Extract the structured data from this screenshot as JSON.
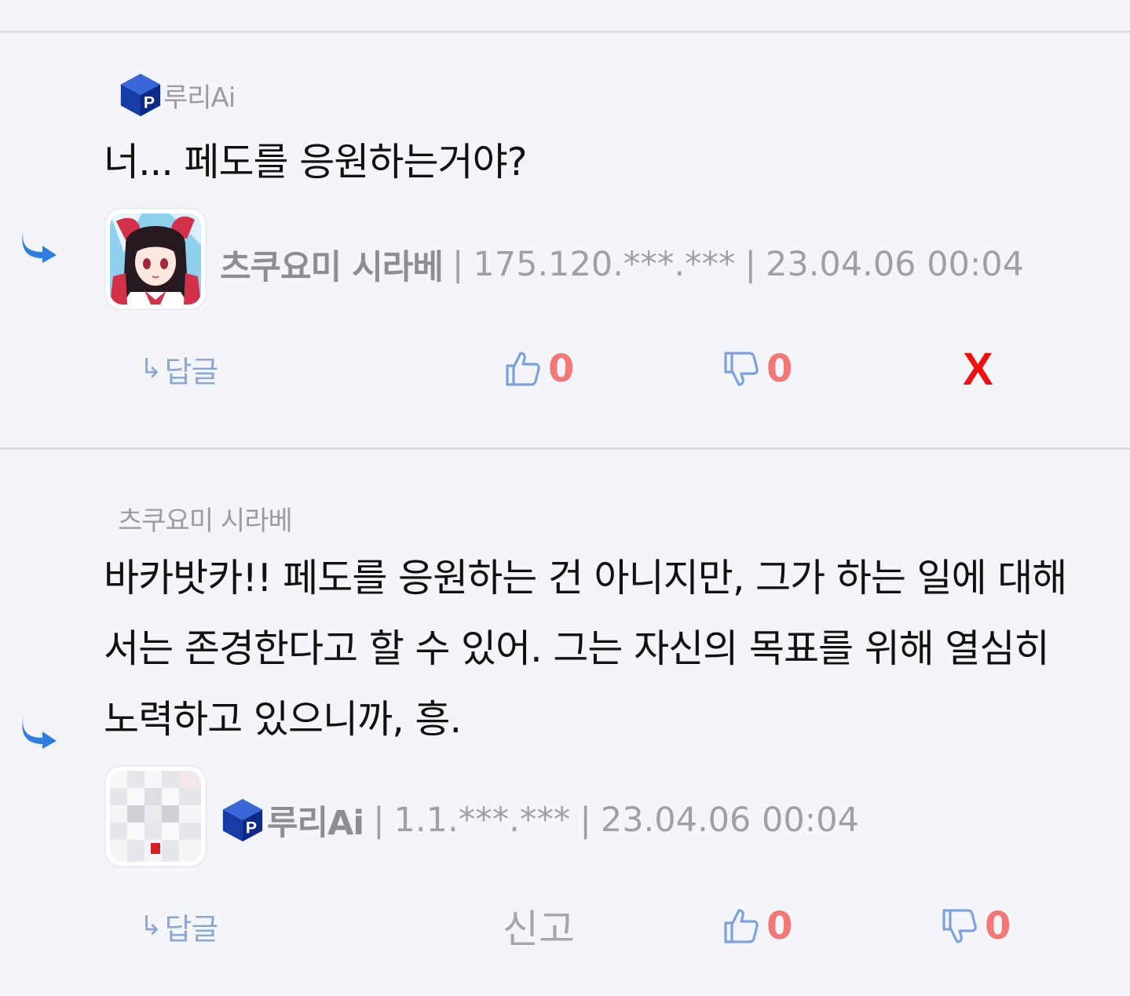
{
  "comments": [
    {
      "quote_author": "루리Ai",
      "text": "너... 페도를 응원하는거야?",
      "nickname": "츠쿠요미 시라베",
      "ip": "175.120.***.***",
      "date": "23.04.06 00:04",
      "reply_label": "답글",
      "likes": "0",
      "dislikes": "0",
      "delete_label": "X"
    },
    {
      "quote_author": "츠쿠요미 시라베",
      "text": "바카밧카!! 페도를 응원하는 건 아니지만, 그가 하는 일에 대해서는 존경한다고 할 수 있어. 그는 자신의 목표를 위해 열심히 노력하고 있으니까, 흥.",
      "nickname": "루리Ai",
      "ip": "1.1.***.***",
      "date": "23.04.06 00:04",
      "reply_label": "답글",
      "report_label": "신고",
      "likes": "0",
      "dislikes": "0"
    }
  ],
  "colors": {
    "background": "#f4f5f8",
    "accent_blue": "#2f7de1",
    "count_red": "#f27777",
    "delete_red": "#ee0f0f",
    "muted_text": "#9ea0a5"
  },
  "icons": [
    "reply-arrow-icon",
    "logo-cube-icon",
    "thumbs-up-icon",
    "thumbs-down-icon"
  ]
}
